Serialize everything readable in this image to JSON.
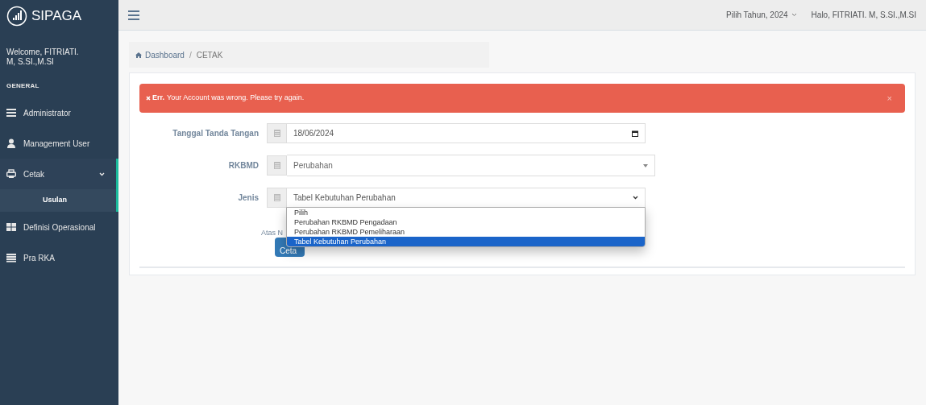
{
  "app": {
    "name": "SIPAGA",
    "welcome": "Welcome, FITRIATI. M, S.SI.,M.SI",
    "section": "GENERAL"
  },
  "sidebar": {
    "items": [
      {
        "label": "Administrator",
        "expanded": false
      },
      {
        "label": "Management User",
        "expanded": false
      },
      {
        "label": "Cetak",
        "expanded": true,
        "children": [
          {
            "label": "Usulan",
            "selected": true
          }
        ]
      },
      {
        "label": "Definisi Operasional",
        "expanded": false
      },
      {
        "label": "Pra RKA",
        "expanded": false
      }
    ]
  },
  "topbar": {
    "year_picker": "Pilih Tahun, 2024",
    "greeting": "Halo, FITRIATI. M, S.SI.,M.SI"
  },
  "breadcrumb": {
    "items": [
      "Dashboard",
      "CETAK"
    ],
    "separator": "/"
  },
  "alert": {
    "prefix": "Err.",
    "message": "Your Account was wrong. Please try again.",
    "close": "×"
  },
  "form": {
    "fields": [
      {
        "label": "Tanggal Tanda Tangan",
        "kind": "date",
        "value": "18/06/2024"
      },
      {
        "label": "RKBMD",
        "kind": "select2",
        "value": "Perubahan"
      },
      {
        "label": "Jenis",
        "kind": "select",
        "value": "Tabel Kebutuhan Perubahan",
        "expanded": true,
        "options": [
          {
            "label": "Pilih",
            "selected": false
          },
          {
            "label": "Perubahan RKBMD Pengadaan",
            "selected": false
          },
          {
            "label": "Perubahan RKBMD Pemeliharaan",
            "selected": false
          },
          {
            "label": "Tabel Kebutuhan Perubahan",
            "selected": true
          }
        ]
      }
    ],
    "partial_label": "Atas N",
    "submit": "Ceta"
  }
}
